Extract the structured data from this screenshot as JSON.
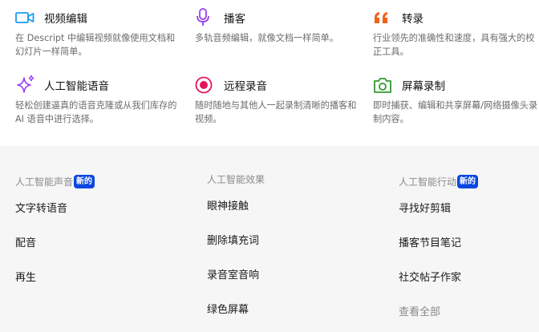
{
  "features": [
    {
      "title": "视频编辑",
      "desc": "在 Descript 中编辑视频就像使用文档和幻灯片一样简单。",
      "icon": "video-camera-icon",
      "color": "#1a9bef"
    },
    {
      "title": "播客",
      "desc": "多轨音频编辑，就像文档一样简单。",
      "icon": "microphone-icon",
      "color": "#9b3df0"
    },
    {
      "title": "转录",
      "desc": "行业领先的准确性和速度，具有强大的校正工具。",
      "icon": "quote-icon",
      "color": "#f06018"
    },
    {
      "title": "人工智能语音",
      "desc": "轻松创建逼真的语音克隆或从我们库存的 AI 语音中进行选择。",
      "icon": "sparkle-icon",
      "color": "#9b3df0"
    },
    {
      "title": "远程录音",
      "desc": "随时随地与其他人一起录制清晰的播客和视频。",
      "icon": "record-icon",
      "color": "#e5145a"
    },
    {
      "title": "屏幕录制",
      "desc": "即时捕获、编辑和共享屏幕/网络摄像头录制内容。",
      "icon": "camera-icon",
      "color": "#2f9a2f"
    }
  ],
  "columns": [
    {
      "label": "人工智能声音",
      "badge": "新的",
      "links": [
        "文字转语音",
        "配音",
        "再生"
      ]
    },
    {
      "label": "人工智能效果",
      "badge": "",
      "links": [
        "眼神接触",
        "删除填充词",
        "录音室音响",
        "绿色屏幕"
      ]
    },
    {
      "label": "人工智能行动",
      "badge": "新的",
      "links": [
        "寻找好剪辑",
        "播客节目笔记",
        "社交帖子作家"
      ],
      "see_all": "查看全部"
    }
  ]
}
